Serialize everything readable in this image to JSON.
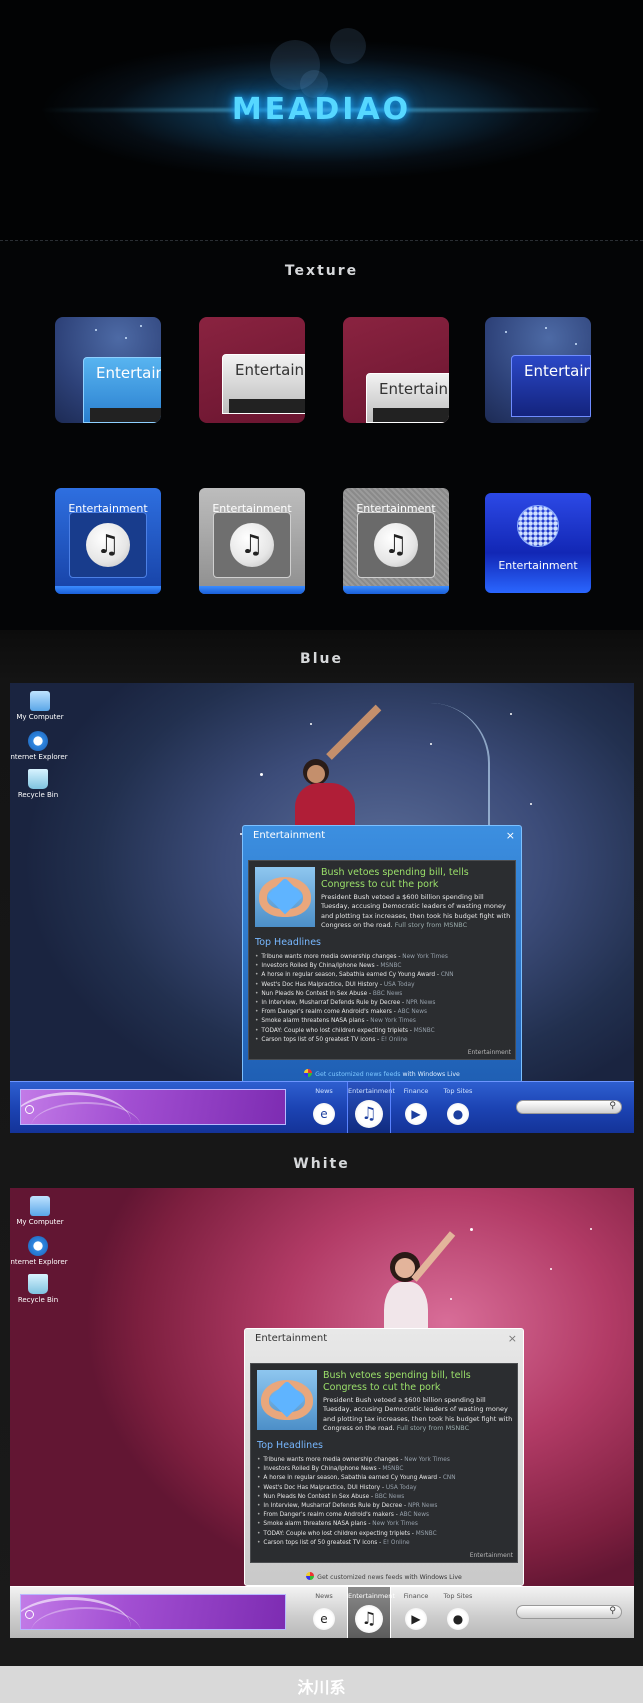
{
  "hero": {
    "brand": "MEADIAO"
  },
  "sections": {
    "texture": "Texture",
    "blue": "Blue",
    "white": "White"
  },
  "texture": {
    "window_tiles": [
      "Entertainment",
      "Entertainment",
      "Entertainment",
      "Entertainment"
    ],
    "icon_tiles": [
      "Entertainment",
      "Entertainment",
      "Entertainment",
      "Entertainment"
    ]
  },
  "desktop_icons": [
    "My Computer",
    "Internet Explorer",
    "Recycle Bin"
  ],
  "gadget": {
    "title": "Entertainment",
    "close": "×",
    "headline": "Bush vetoes spending bill, tells Congress to cut the pork",
    "summary": "President Bush vetoed a $600 billion spending bill Tuesday, accusing Democratic leaders of wasting money and plotting tax increases, then took his budget fight with Congress on the road.",
    "full_story": "Full story from MSNBC",
    "top_headlines_label": "Top Headlines",
    "headlines": [
      {
        "text": "Tribune wants more media ownership changes",
        "source": "New York Times"
      },
      {
        "text": "Investors Roiled By China/Iphone News",
        "source": "MSNBC"
      },
      {
        "text": "A horse in regular season, Sabathia earned Cy Young Award",
        "source": "CNN"
      },
      {
        "text": "West's Doc Has Malpractice, DUI History",
        "source": "USA Today"
      },
      {
        "text": "Nun Pleads No Contest in Sex Abuse",
        "source": "BBC News"
      },
      {
        "text": "In Interview, Musharraf Defends Rule by Decree",
        "source": "NPR News"
      },
      {
        "text": "From Danger's realm come Android's makers",
        "source": "ABC News"
      },
      {
        "text": "Smoke alarm threatens NASA plans",
        "source": "New York Times"
      },
      {
        "text": "TODAY: Couple who lost children expecting triplets",
        "source": "MSNBC"
      },
      {
        "text": "Carson tops list of 50 greatest TV icons",
        "source": "E! Online"
      }
    ],
    "corner_label": "Entertainment",
    "footer_link": "Get customized news feeds",
    "footer_rest": " with Windows Live"
  },
  "taskbar": {
    "categories": [
      "News",
      "Entertainment",
      "Finance",
      "Top Sites"
    ],
    "icons": [
      "ie-icon",
      "music-note-icon",
      "play-icon",
      "user-icon"
    ]
  },
  "footer": {
    "brand": "沐川系"
  }
}
